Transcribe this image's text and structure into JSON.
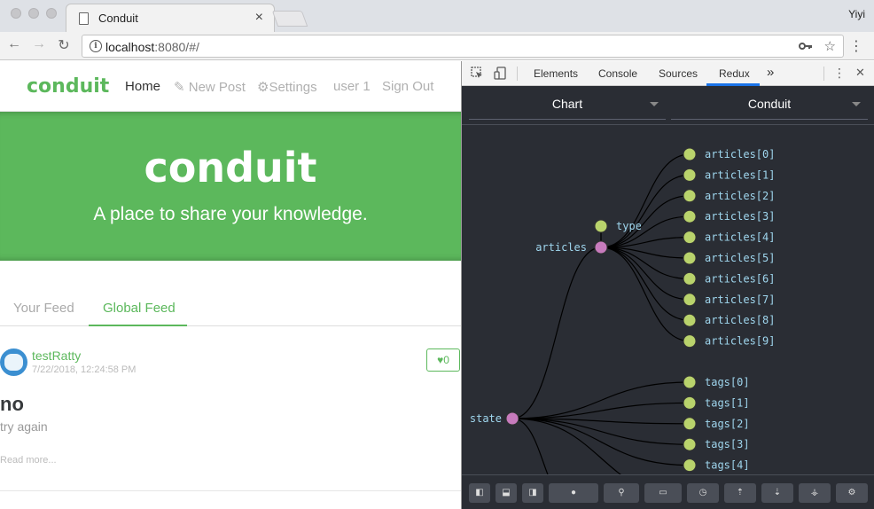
{
  "browser": {
    "tab_title": "Conduit",
    "tab_close": "×",
    "profile_name": "Yiyi",
    "url_host": "localhost",
    "url_rest": ":8080/#/",
    "icons": [
      "back-icon",
      "forward-icon",
      "reload-icon",
      "info-icon",
      "key-icon",
      "star-icon",
      "menu-icon"
    ]
  },
  "app": {
    "brand": "conduit",
    "nav": [
      {
        "label": "Home",
        "active": true
      },
      {
        "label": "New Post",
        "icon": "compose-icon"
      },
      {
        "label": "Settings",
        "icon": "gear-icon"
      },
      {
        "label": "user 1"
      },
      {
        "label": "Sign Out"
      }
    ],
    "banner": {
      "title": "conduit",
      "subtitle": "A place to share your knowledge."
    },
    "feed_tabs": [
      {
        "label": "Your Feed",
        "active": false
      },
      {
        "label": "Global Feed",
        "active": true
      }
    ],
    "article": {
      "author": "testRatty",
      "date": "7/22/2018, 12:24:58 PM",
      "likes": "0",
      "title": "no",
      "description": "try again",
      "read_more": "Read more..."
    },
    "accent_color": "#5cb85c"
  },
  "devtools": {
    "tabs": [
      {
        "label": "Elements"
      },
      {
        "label": "Console"
      },
      {
        "label": "Sources"
      },
      {
        "label": "Redux",
        "active": true
      }
    ],
    "overflow": "»",
    "close": "✕",
    "redux": {
      "monitor_select": "Chart",
      "store_select": "Conduit",
      "tree": {
        "root": "state",
        "branches": [
          "articles",
          "type"
        ],
        "articles": [
          "articles[0]",
          "articles[1]",
          "articles[2]",
          "articles[3]",
          "articles[4]",
          "articles[5]",
          "articles[6]",
          "articles[7]",
          "articles[8]",
          "articles[9]"
        ],
        "tags": [
          "tags[0]",
          "tags[1]",
          "tags[2]",
          "tags[3]",
          "tags[4]"
        ]
      },
      "node_colors": {
        "parent": "#c77bbd",
        "leaf": "#b9d36c",
        "link": "#000000"
      },
      "footer_buttons": [
        "dock-left-icon",
        "dock-bottom-icon",
        "dock-right-icon",
        "dispatcher-icon",
        "pin-icon",
        "keyboard-icon",
        "timer-icon",
        "export-icon",
        "import-icon",
        "remote-icon",
        "settings-icon"
      ]
    }
  }
}
